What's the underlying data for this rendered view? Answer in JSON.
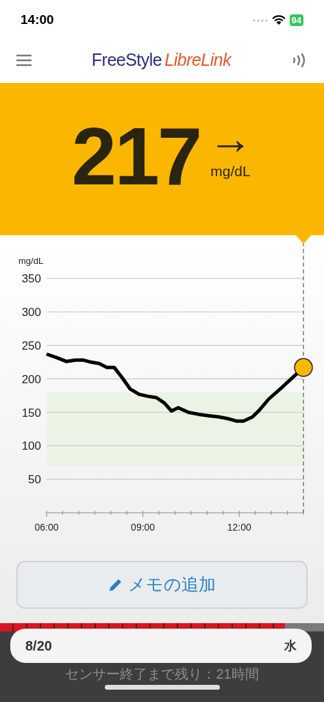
{
  "status_bar": {
    "time": "14:00",
    "battery": "94"
  },
  "header": {
    "logo_part_1": "FreeStyle",
    "logo_part_2": "LibreLink"
  },
  "reading": {
    "value": "217",
    "arrow": "→",
    "unit": "mg/dL"
  },
  "chart": {
    "unit": "mg/dL",
    "chart_data": {
      "type": "line",
      "grid": true,
      "bands": [
        {
          "axis": "y",
          "from": 70,
          "to": 180,
          "color": "#ebf4e4"
        }
      ],
      "x": [
        6.0,
        6.3,
        6.62,
        6.9,
        7.15,
        7.39,
        7.64,
        7.88,
        8.11,
        8.35,
        8.6,
        8.88,
        9.16,
        9.42,
        9.67,
        9.89,
        10.1,
        10.42,
        10.74,
        11.06,
        11.38,
        11.7,
        11.91,
        12.13,
        12.41,
        12.62,
        12.92,
        13.3,
        13.73,
        14.0
      ],
      "series": [
        {
          "color": "#000000",
          "values": [
            237,
            232,
            226,
            228,
            228,
            225,
            223,
            217,
            217,
            202,
            185,
            177,
            174,
            172,
            164,
            152,
            157,
            150,
            147,
            145,
            143,
            140,
            137,
            137,
            143,
            153,
            170,
            186,
            205,
            217
          ]
        }
      ],
      "xlim": [
        6,
        14
      ],
      "ylim": [
        0,
        350
      ],
      "xticks": [
        {
          "value": 6,
          "label": "06:00"
        },
        {
          "value": 9,
          "label": "09:00"
        },
        {
          "value": 12,
          "label": "12:00"
        }
      ],
      "yticks": [
        50,
        100,
        150,
        200,
        250,
        300,
        350
      ]
    }
  },
  "memo_button": {
    "label": "メモの追加"
  },
  "sensor_bar": {
    "level": 0.88
  },
  "date_pill": {
    "date": "8/20",
    "weekday": "水"
  },
  "sensor_text": "センサー終了まで残り：21時間"
}
